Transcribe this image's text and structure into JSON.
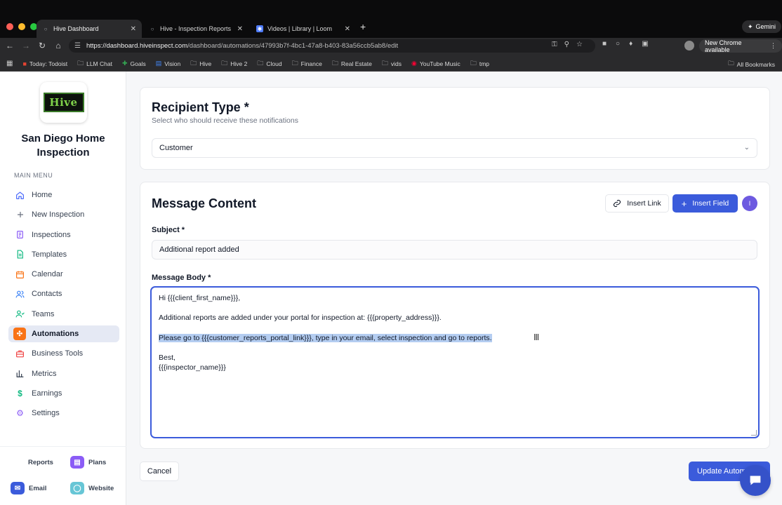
{
  "browser": {
    "tabs": [
      {
        "label": "Hive Dashboard",
        "active": true
      },
      {
        "label": "Hive - Inspection Reports",
        "active": false
      },
      {
        "label": "Videos | Library | Loom",
        "active": false
      }
    ],
    "gemini_label": "Gemini",
    "url_host": "https://dashboard.hiveinspect.com",
    "url_path": "/dashboard/automations/47993b7f-4bc1-47a8-b403-83a56ccb5ab8/edit",
    "new_chrome_label": "New Chrome available",
    "bookmarks": [
      "Today: Todoist",
      "LLM Chat",
      "Goals",
      "Vision",
      "Hive",
      "Hive 2",
      "Cloud",
      "Finance",
      "Real Estate",
      "vids",
      "YouTube Music",
      "tmp"
    ],
    "all_bookmarks": "All Bookmarks"
  },
  "sidebar": {
    "logo_text": "Hive",
    "company": "San Diego Home Inspection",
    "menu_label": "MAIN MENU",
    "items": [
      {
        "label": "Home",
        "icon": "home-icon",
        "color": "#4b6bfb"
      },
      {
        "label": "New Inspection",
        "icon": "plus-icon",
        "color": "#6b7280"
      },
      {
        "label": "Inspections",
        "icon": "clipboard-icon",
        "color": "#8b5cf6"
      },
      {
        "label": "Templates",
        "icon": "document-icon",
        "color": "#10b981"
      },
      {
        "label": "Calendar",
        "icon": "calendar-icon",
        "color": "#f97316"
      },
      {
        "label": "Contacts",
        "icon": "users-icon",
        "color": "#3b82f6"
      },
      {
        "label": "Teams",
        "icon": "team-icon",
        "color": "#10b981"
      },
      {
        "label": "Automations",
        "icon": "bolt-icon",
        "color": "#f97316",
        "active": true
      },
      {
        "label": "Business Tools",
        "icon": "briefcase-icon",
        "color": "#ef4444"
      },
      {
        "label": "Metrics",
        "icon": "bar-chart-icon",
        "color": "#374151"
      },
      {
        "label": "Earnings",
        "icon": "dollar-icon",
        "color": "#10b981"
      },
      {
        "label": "Settings",
        "icon": "gear-icon",
        "color": "#8b5cf6"
      }
    ],
    "bottom": {
      "reports": "Reports",
      "plans": "Plans",
      "email": "Email",
      "website": "Website"
    }
  },
  "recipient": {
    "title": "Recipient Type *",
    "subtitle": "Select who should receive these notifications",
    "selected": "Customer"
  },
  "message": {
    "title": "Message Content",
    "insert_link": "Insert Link",
    "insert_field": "Insert Field",
    "avatar_initial": "I",
    "subject_label": "Subject *",
    "subject_value": "Additional report added",
    "body_label": "Message Body *",
    "body_lines": [
      "Hi {{{client_first_name}}},",
      "",
      "Additional reports are added under your portal for inspection at: {{{property_address}}}.",
      "",
      "Please go to {{{customer_reports_portal_link}}}, type in your email, select inspection and go to reports.",
      "",
      "Best,",
      "{{{inspector_name}}}"
    ],
    "selected_line_index": 4
  },
  "footer": {
    "cancel": "Cancel",
    "update": "Update Autom"
  }
}
